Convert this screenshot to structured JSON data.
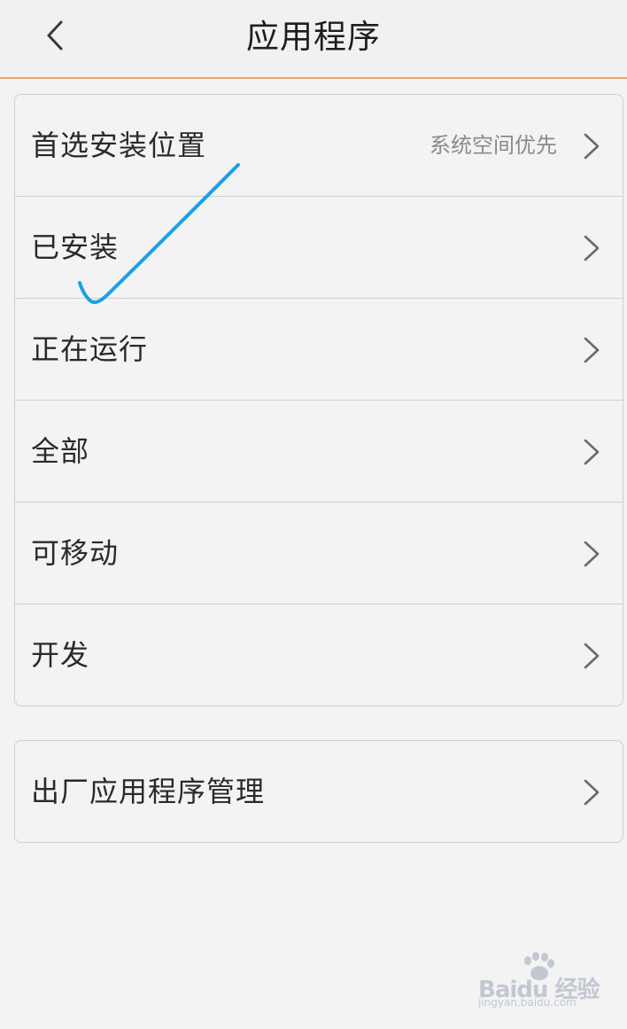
{
  "header": {
    "title": "应用程序"
  },
  "main_list": {
    "items": [
      {
        "label": "首选安装位置",
        "value": "系统空间优先"
      },
      {
        "label": "已安装",
        "value": ""
      },
      {
        "label": "正在运行",
        "value": ""
      },
      {
        "label": "全部",
        "value": ""
      },
      {
        "label": "可移动",
        "value": ""
      },
      {
        "label": "开发",
        "value": ""
      }
    ]
  },
  "factory_list": {
    "items": [
      {
        "label": "出厂应用程序管理"
      }
    ]
  },
  "watermark": {
    "brand": "Baidu 经验",
    "url": "jingyan.baidu.com"
  },
  "colors": {
    "header_divider": "#f0a35c",
    "annotation_stroke": "#1ea0e6",
    "chevron": "#6a6a6a"
  },
  "icons": {
    "back": "chevron-left-icon",
    "row_arrow": "chevron-right-icon"
  }
}
